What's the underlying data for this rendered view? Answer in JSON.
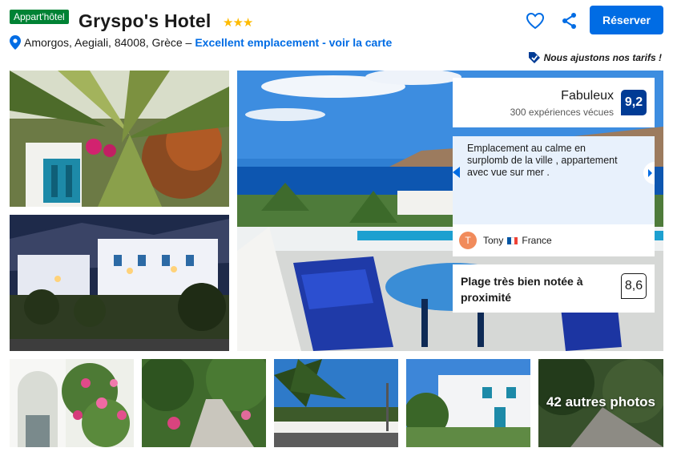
{
  "header": {
    "type_badge": "Appart'hôtel",
    "hotel_name": "Gryspo's Hotel",
    "stars": "★★★",
    "address": "Amorgos, Aegiali, 84008, Grèce –",
    "map_link": "Excellent emplacement - voir la carte",
    "reserve_label": "Réserver",
    "price_match": "Nous ajustons nos tarifs !"
  },
  "gallery": {
    "more_photos": "42 autres photos"
  },
  "rating": {
    "word": "Fabuleux",
    "score": "9,2",
    "subtitle": "300 expériences vécues"
  },
  "review": {
    "text": "Emplacement au calme en surplomb de la ville , appartement avec vue sur mer .",
    "avatar_initial": "T",
    "reviewer_name": "Tony",
    "reviewer_country": "France"
  },
  "nearby": {
    "label": "Plage très bien notée à proximité",
    "score": "8,6"
  },
  "colors": {
    "brand_blue": "#006ce4",
    "score_blue": "#003b95",
    "badge_green": "#008234",
    "star_yellow": "#febb02",
    "review_bg": "#e8f1fc"
  },
  "icons": [
    "map-pin-icon",
    "heart-icon",
    "share-icon",
    "price-tag-icon",
    "chevron-left-icon",
    "chevron-right-icon",
    "france-flag-icon"
  ]
}
